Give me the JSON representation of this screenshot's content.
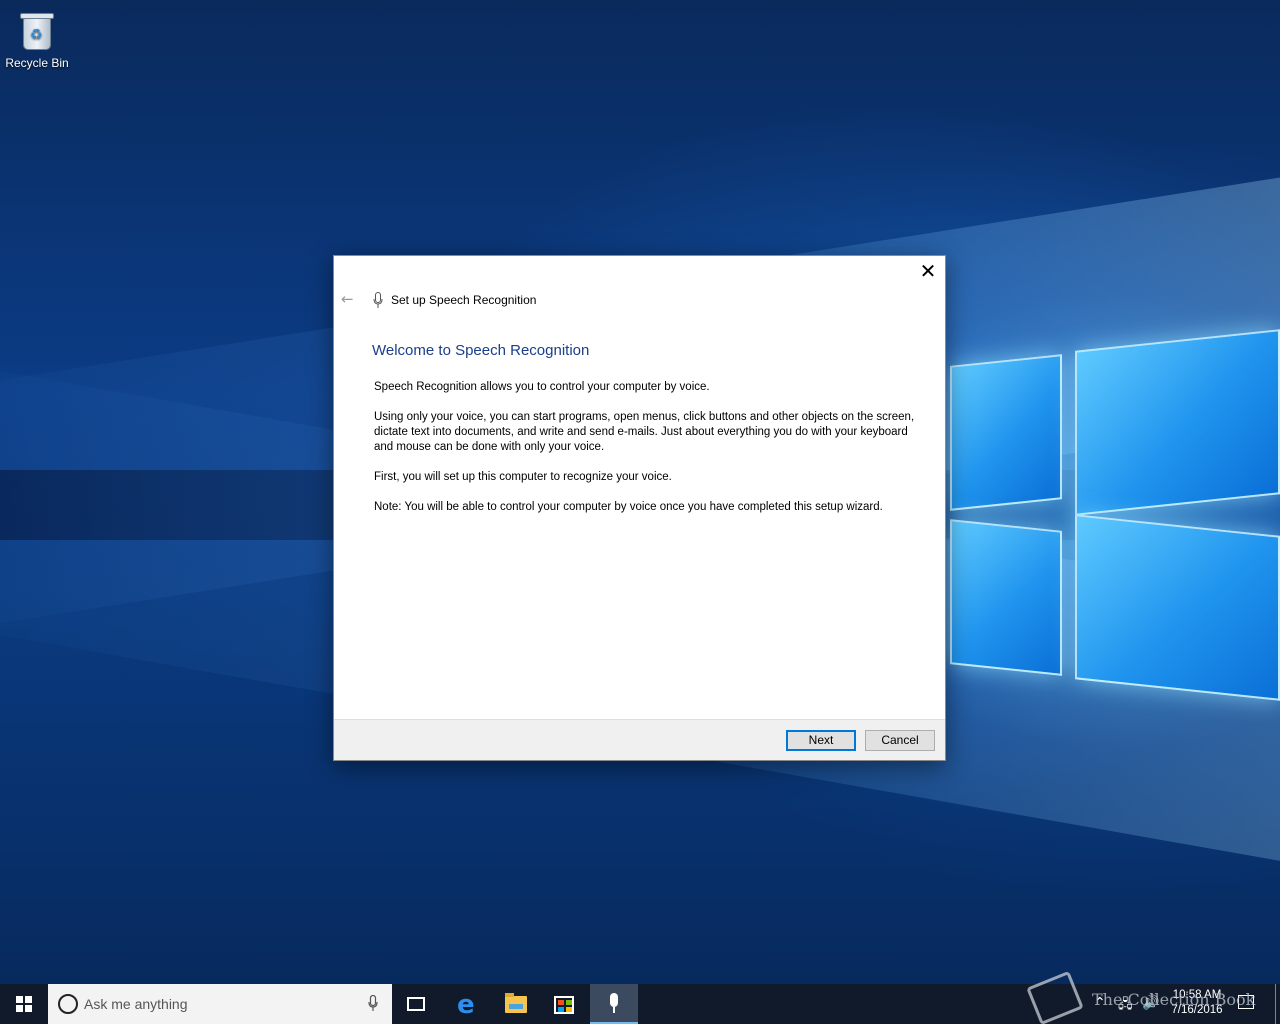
{
  "desktop": {
    "icons": [
      {
        "label": "Recycle Bin"
      }
    ]
  },
  "dialog": {
    "title": "Set up Speech Recognition",
    "heading": "Welcome to Speech Recognition",
    "paragraphs": [
      "Speech Recognition allows you to control your computer by voice.",
      "Using only your voice, you can start programs, open menus, click buttons and other objects on the screen, dictate text into documents, and write and send e-mails. Just about everything you do with your keyboard and mouse can be done with only your voice.",
      "First, you will set up this computer to recognize your voice.",
      "Note: You will be able to control your computer by voice once you have completed this setup wizard."
    ],
    "next_label": "Next",
    "cancel_label": "Cancel",
    "close_glyph": "✕",
    "back_glyph": "←",
    "heading_color": "#1a3e8c"
  },
  "taskbar": {
    "search_placeholder": "Ask me anything",
    "pinned": [
      "task-view-icon",
      "edge-icon",
      "file-explorer-icon",
      "store-icon",
      "speech-recognition-icon"
    ],
    "clock_time": "10:58 AM",
    "clock_date": "7/16/2016",
    "accent_color": "#76b9ed"
  },
  "watermark": {
    "text": "The Collection Book"
  }
}
